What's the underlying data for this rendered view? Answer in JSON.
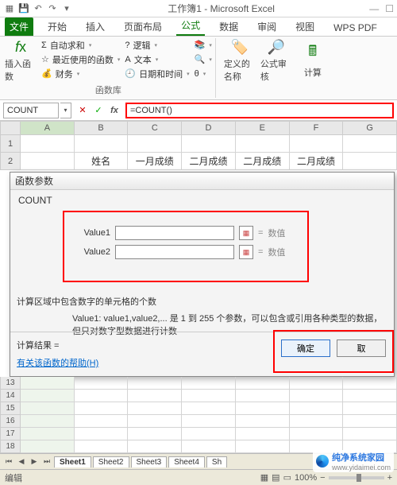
{
  "window": {
    "title": "工作簿1 - Microsoft Excel"
  },
  "tabs": {
    "file": "文件",
    "items": [
      "开始",
      "插入",
      "页面布局",
      "公式",
      "数据",
      "审阅",
      "视图",
      "WPS PDF"
    ],
    "active": "公式"
  },
  "ribbon": {
    "insertfn": "插入函数",
    "autosum": "自动求和",
    "recent": "最近使用的函数",
    "financial": "财务",
    "logical": "逻辑",
    "text": "文本",
    "date": "日期和时间",
    "defname": "定义的名称",
    "audit": "公式审核",
    "calc": "计算",
    "group_label": "函数库"
  },
  "formulabar": {
    "namebox": "COUNT",
    "formula": "=COUNT()"
  },
  "columns": [
    "A",
    "B",
    "C",
    "D",
    "E",
    "F",
    "G"
  ],
  "headers": {
    "r2": [
      "",
      "姓名",
      "一月成绩",
      "二月成绩",
      "二月成绩",
      "二月成绩",
      ""
    ]
  },
  "dialog": {
    "title": "函数参数",
    "func": "COUNT",
    "args": [
      {
        "label": "Value1",
        "hint": "数值"
      },
      {
        "label": "Value2",
        "hint": "数值"
      }
    ],
    "desc": "计算区域中包含数字的单元格的个数",
    "desc2": "Value1: value1,value2,... 是 1 到 255 个参数，可以包含或引用各种类型的数据，但只对数字型数据进行计数",
    "result_label": "计算结果 =",
    "help": "有关该函数的帮助(H)",
    "ok": "确定",
    "cancel": "取"
  },
  "rows_bottom": [
    "13",
    "14",
    "15",
    "16",
    "17",
    "18"
  ],
  "sheets": [
    "Sheet1",
    "Sheet2",
    "Sheet3",
    "Sheet4",
    "Sh"
  ],
  "status": {
    "mode": "编辑",
    "zoom": "100%"
  },
  "watermark": {
    "line1": "纯净系统家园",
    "line2": "www.yidaimei.com"
  }
}
